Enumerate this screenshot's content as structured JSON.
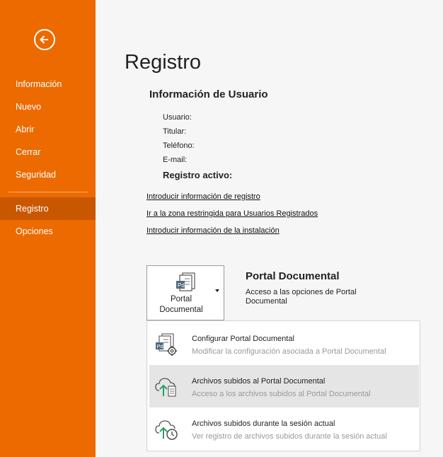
{
  "sidebar": {
    "back_icon": "arrow-left-circle-icon",
    "items": [
      {
        "label": "Información"
      },
      {
        "label": "Nuevo"
      },
      {
        "label": "Abrir"
      },
      {
        "label": "Cerrar"
      },
      {
        "label": "Seguridad"
      },
      {
        "label": "Registro",
        "active": true
      },
      {
        "label": "Opciones"
      }
    ]
  },
  "main": {
    "title": "Registro",
    "user_info": {
      "heading": "Información de Usuario",
      "usuario_label": "Usuario:",
      "titular_label": "Titular:",
      "telefono_label": "Teléfono:",
      "email_label": "E-mail:",
      "active_label": "Registro activo:"
    },
    "links": [
      "Introducir información de registro",
      "Ir a la zona restringida para Usuarios Registrados",
      "Introducir información de la instalación"
    ],
    "portal": {
      "button_line1": "Portal",
      "button_line2": "Documental",
      "title": "Portal Documental",
      "description": "Acceso a las opciones de Portal Documental"
    },
    "dropdown": [
      {
        "title": "Configurar Portal Documental",
        "subtitle": "Modificar la configuración asociada a Portal Documental",
        "icon": "document-gear-icon"
      },
      {
        "title": "Archivos subidos al Portal Documental",
        "subtitle": "Acceso a los archivos subidos al Portal Documental",
        "icon": "cloud-upload-document-icon"
      },
      {
        "title": "Archivos subidos durante la sesión actual",
        "subtitle": "Ver registro de archivos subidos durante la sesión actual",
        "icon": "cloud-upload-clock-icon"
      }
    ]
  },
  "colors": {
    "sidebar_bg": "#ec6a00",
    "sidebar_active": "#c85700",
    "content_bg": "#f6f6f6",
    "accent_green": "#21a366"
  }
}
